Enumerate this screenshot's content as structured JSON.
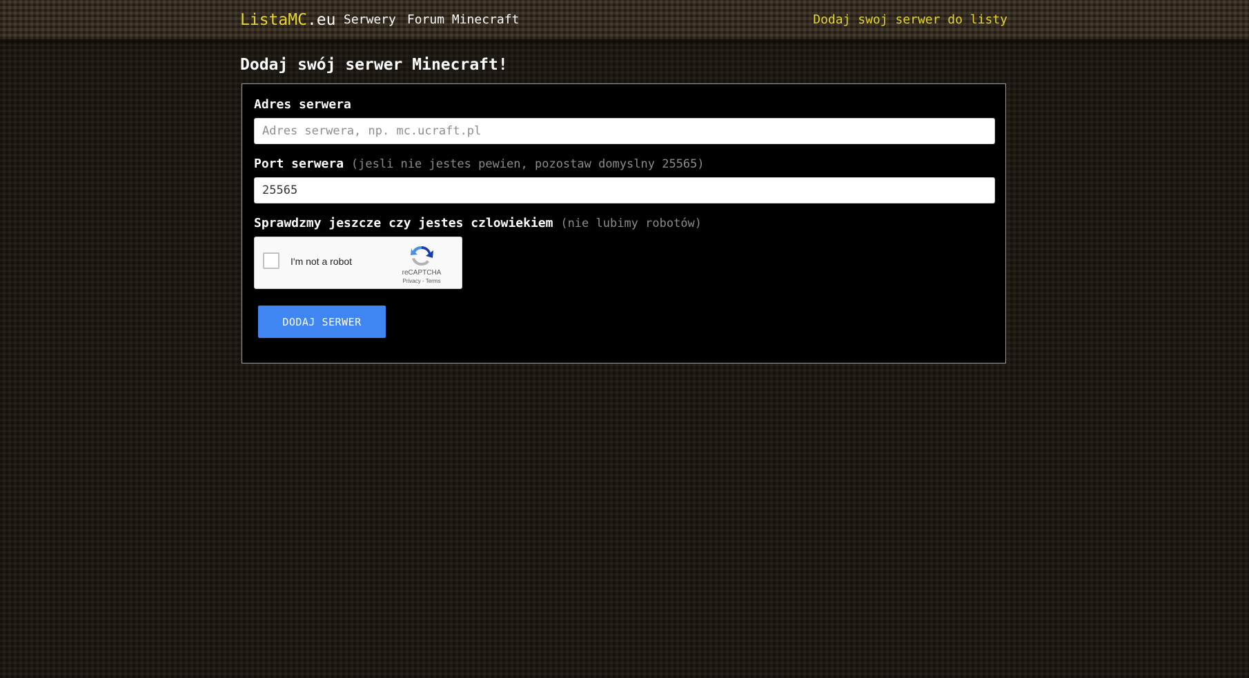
{
  "header": {
    "brand_part1": "ListaMC",
    "brand_part2": ".eu",
    "nav": [
      {
        "label": "Serwery"
      },
      {
        "label": "Forum Minecraft"
      }
    ],
    "add_server_link": "Dodaj swoj serwer do listy"
  },
  "page": {
    "title": "Dodaj swój serwer Minecraft!"
  },
  "form": {
    "address_label": "Adres serwera",
    "address_placeholder": "Adres serwera, np. mc.ucraft.pl",
    "address_value": "",
    "port_label": "Port serwera",
    "port_hint": "(jesli nie jestes pewien, pozostaw domyslny 25565)",
    "port_value": "25565",
    "captcha_label": "Sprawdzmy jeszcze czy jestes czlowiekiem",
    "captcha_hint": "(nie lubimy robotów)",
    "submit_label": "DODAJ SERWER"
  },
  "recaptcha": {
    "checkbox_label": "I'm not a robot",
    "brand": "reCAPTCHA",
    "privacy": "Privacy",
    "separator": " - ",
    "terms": "Terms"
  },
  "colors": {
    "accent_yellow": "#e6d52f",
    "button_blue": "#3f86f2",
    "panel_bg": "#000000",
    "page_bg": "#1e1912"
  }
}
